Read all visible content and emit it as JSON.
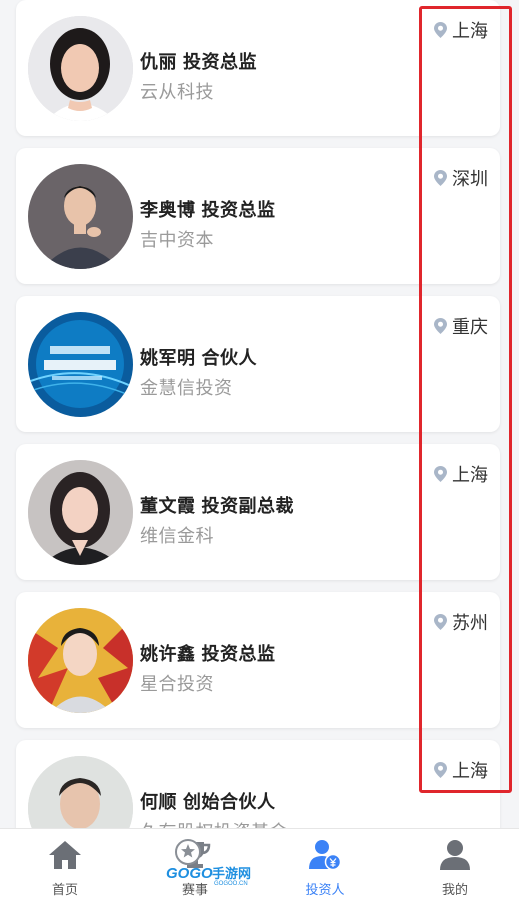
{
  "investors": [
    {
      "name": "仇丽",
      "title": "投资总监",
      "company": "云从科技",
      "city": "上海"
    },
    {
      "name": "李奥博",
      "title": "投资总监",
      "company": "吉中资本",
      "city": "深圳"
    },
    {
      "name": "姚军明",
      "title": "合伙人",
      "company": "金慧信投资",
      "city": "重庆"
    },
    {
      "name": "董文霞",
      "title": "投资副总裁",
      "company": "维信金科",
      "city": "上海"
    },
    {
      "name": "姚许鑫",
      "title": "投资总监",
      "company": "星合投资",
      "city": "苏州"
    },
    {
      "name": "何顺",
      "title": "创始合伙人",
      "company": "久有股权投资基金",
      "city": "上海"
    }
  ],
  "tabbar": {
    "items": [
      {
        "label": "首页",
        "icon": "home-icon"
      },
      {
        "label": "赛事",
        "icon": "trophy-icon"
      },
      {
        "label": "投资人",
        "icon": "investor-icon",
        "active": true
      },
      {
        "label": "我的",
        "icon": "profile-icon"
      }
    ]
  },
  "watermark": {
    "brand": "GOGO手游网",
    "url": "GOGOO.CN"
  },
  "colors": {
    "accent": "#3b82f6",
    "highlight": "#e0262c",
    "pin": "#a9b6c8"
  }
}
